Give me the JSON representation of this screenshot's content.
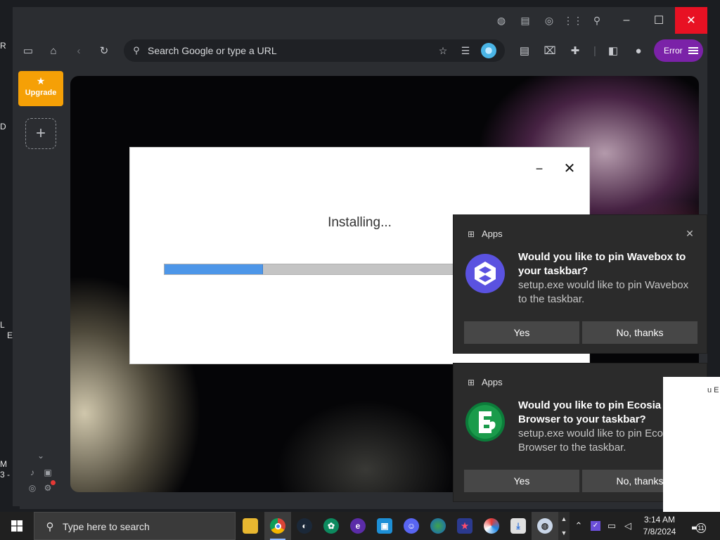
{
  "desktop": {
    "left_fragments": [
      "R",
      "D",
      "L",
      "E",
      "M",
      "3 -"
    ]
  },
  "browser": {
    "titlebar_icons": [
      "globe-icon",
      "reader-icon",
      "compass-icon",
      "apps-grid-icon",
      "search-icon"
    ],
    "window_controls": {
      "minimize": "–",
      "maximize": "☐",
      "close": "✕"
    },
    "toolbar_icons": [
      "sidebar-icon",
      "home-icon",
      "back-icon",
      "reload-icon"
    ],
    "omnibox": {
      "placeholder": "Search Google or type a URL"
    },
    "omnibox_icons": [
      "bookmark-star-icon",
      "tab-stack-icon"
    ],
    "right_toolbar_icons": [
      "reading-list-icon",
      "gift-icon",
      "extensions-icon",
      "side-panel-icon",
      "profile-icon"
    ],
    "error_button": {
      "label": "Error"
    }
  },
  "sidebar": {
    "upgrade": {
      "label": "Upgrade",
      "icon": "star-icon"
    },
    "add_space": {
      "symbol": "+"
    },
    "bottom_icons": [
      "chevron-down-icon",
      "bell-icon",
      "lock-icon",
      "compass-icon",
      "settings-icon"
    ]
  },
  "installer": {
    "status": "Installing...",
    "progress": 0.25,
    "minimize_symbol": "−",
    "close_symbol": "✕"
  },
  "toasts": [
    {
      "app": "Apps",
      "title": "Would you like to pin Wavebox to your taskbar?",
      "body": "setup.exe would like to pin Wavebox to the taskbar.",
      "yes": "Yes",
      "no": "No, thanks",
      "logo": "wavebox-logo"
    },
    {
      "app": "Apps",
      "title": "Would you like to pin Ecosia Browser to your taskbar?",
      "body": "setup.exe would like to pin Ecosia Browser to the taskbar.",
      "yes": "Yes",
      "no": "No, thanks",
      "logo": "ecosia-logo"
    }
  ],
  "peek": {
    "text": "u E"
  },
  "taskbar": {
    "search_placeholder": "Type here to search",
    "apps": [
      "file-explorer",
      "chrome",
      "steam",
      "chatgpt",
      "app-e",
      "vmware",
      "discord",
      "earth",
      "app-star",
      "app-ring",
      "downloads",
      "app-globe"
    ],
    "clock": {
      "time": "3:14 AM",
      "date": "7/8/2024"
    },
    "notification_count": "11"
  },
  "colors": {
    "accent_error": "#7b22a8",
    "upgrade": "#f5a006",
    "progress": "#4d96e8",
    "close_red": "#e81123"
  }
}
